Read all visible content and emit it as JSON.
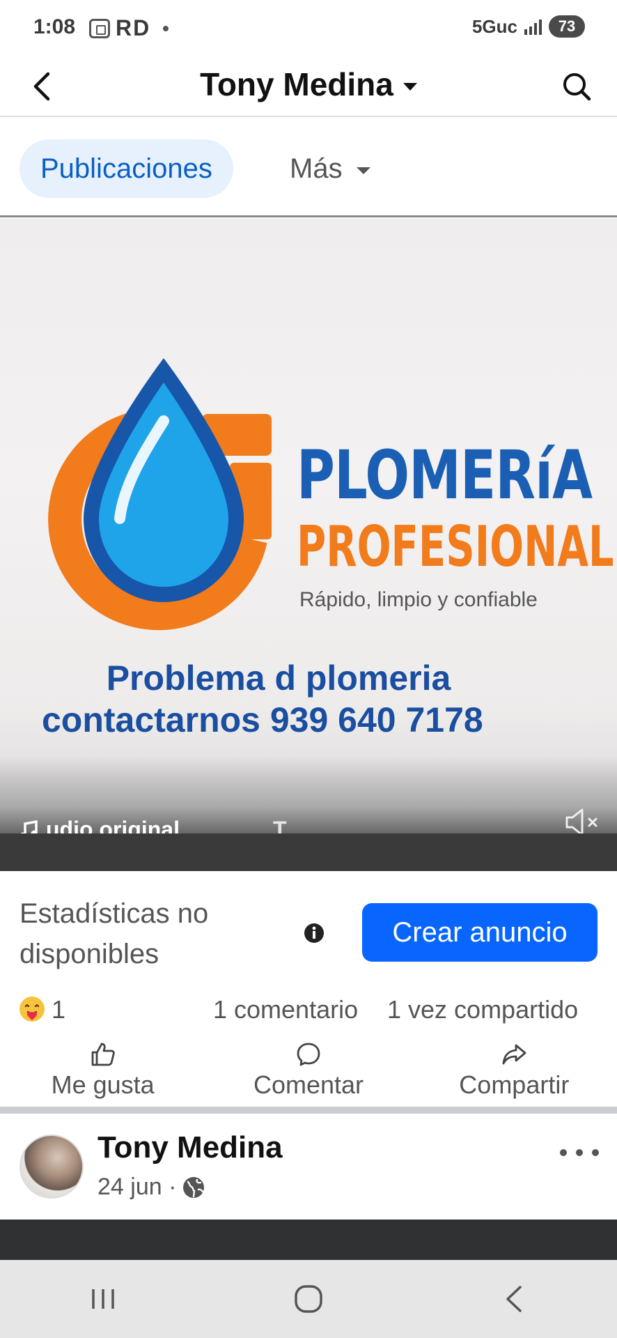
{
  "status_bar": {
    "time": "1:08",
    "carrier_letters": "RD",
    "network": "5Guc",
    "battery": "73"
  },
  "header": {
    "title": "Tony Medina",
    "back_icon": "back-arrow-icon",
    "search_icon": "search-icon"
  },
  "tabs": {
    "active": "Publicaciones",
    "more": "Más"
  },
  "media": {
    "brand_line1": "PLOMERíA",
    "brand_line2": "PROFESIONAL",
    "tagline": "Rápido, limpio y confiable",
    "promo_line1": "Problema d plomeria",
    "promo_line2": "contactarnos 939 640 7178",
    "audio_label": "udio original",
    "audio_trailing": "T",
    "colors": {
      "blue": "#1a5fb4",
      "orange": "#f27b1b"
    }
  },
  "stats": {
    "text": "Estadísticas no disponibles",
    "create_ad": "Crear anuncio",
    "accent": "#0866ff"
  },
  "reactions": {
    "count": "1",
    "comments": "1 comentario",
    "shares": "1 vez compartido"
  },
  "actions": {
    "like": "Me gusta",
    "comment": "Comentar",
    "share": "Compartir"
  },
  "next_post": {
    "author": "Tony Medina",
    "date": "24 jun ·"
  }
}
